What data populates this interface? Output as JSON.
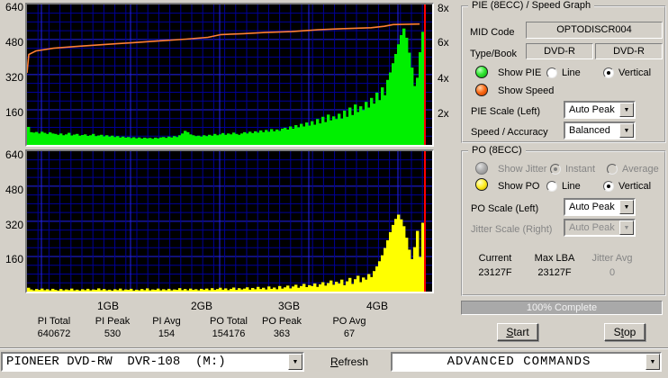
{
  "graph": {
    "left_axis_labels": [
      "640",
      "480",
      "320",
      "160"
    ],
    "right_axis_labels": [
      "8x",
      "6x",
      "4x",
      "2x"
    ],
    "x_axis_labels": [
      "1GB",
      "2GB",
      "3GB",
      "4GB"
    ],
    "position_marker_gb": 4.5,
    "colors": {
      "plot_bg": "#000000",
      "grid_minor": "#000098",
      "grid_major": "#2222ee",
      "pie": "#00f000",
      "po": "#ffff00",
      "speed": "#ff7f33",
      "cursor": "#ff0000"
    }
  },
  "chart_data": [
    {
      "type": "bar",
      "name": "PIE errors (top graph)",
      "color": "#00f000",
      "x_range_gb": [
        0,
        4.5
      ],
      "ylim_left": [
        0,
        640
      ],
      "values": [
        82,
        58,
        56,
        59,
        52,
        60,
        55,
        50,
        57,
        52,
        50,
        46,
        52,
        44,
        48,
        55,
        43,
        47,
        50,
        42,
        45,
        48,
        41,
        44,
        50,
        40,
        43,
        46,
        39,
        44,
        38,
        42,
        36,
        40,
        34,
        38,
        33,
        36,
        31,
        35,
        30,
        34,
        29,
        33,
        30,
        32,
        28,
        33,
        30,
        34,
        36,
        32,
        38,
        34,
        40,
        36,
        44,
        52,
        64,
        58,
        48,
        44,
        40,
        42,
        38,
        44,
        40,
        46,
        42,
        50,
        44,
        48,
        54,
        46,
        52,
        48,
        56,
        50,
        46,
        52,
        58,
        52,
        60,
        54,
        62,
        56,
        66,
        58,
        68,
        60,
        72,
        62,
        70,
        64,
        74,
        78,
        70,
        84,
        74,
        90,
        80,
        96,
        84,
        102,
        88,
        108,
        92,
        118,
        98,
        128,
        104,
        138,
        112,
        130,
        118,
        142,
        120,
        156,
        128,
        170,
        136,
        184,
        150,
        176,
        158,
        196,
        170,
        214,
        188,
        238,
        204,
        262,
        226,
        296,
        330,
        372,
        414,
        458,
        500,
        530,
        488,
        420,
        352,
        268,
        306,
        422,
        515
      ]
    },
    {
      "type": "line",
      "name": "Write speed (top graph)",
      "color": "#ff7f33",
      "ylim_right_x": [
        0,
        8
      ],
      "points_gb_speed": [
        [
          0,
          4.1
        ],
        [
          0.02,
          5.15
        ],
        [
          0.1,
          5.35
        ],
        [
          0.3,
          5.5
        ],
        [
          0.6,
          5.62
        ],
        [
          0.9,
          5.72
        ],
        [
          1.2,
          5.82
        ],
        [
          1.5,
          5.92
        ],
        [
          1.8,
          6.02
        ],
        [
          2.05,
          6.12
        ],
        [
          2.2,
          6.28
        ],
        [
          2.45,
          6.33
        ],
        [
          2.7,
          6.4
        ],
        [
          3.0,
          6.45
        ],
        [
          3.3,
          6.55
        ],
        [
          3.6,
          6.62
        ],
        [
          3.9,
          6.67
        ],
        [
          4.05,
          6.75
        ],
        [
          4.15,
          6.85
        ],
        [
          4.45,
          6.88
        ]
      ]
    },
    {
      "type": "bar",
      "name": "PO errors (bottom graph)",
      "color": "#ffff00",
      "x_range_gb": [
        0,
        4.5
      ],
      "ylim_left": [
        0,
        640
      ],
      "values": [
        18,
        10,
        6,
        12,
        8,
        14,
        7,
        11,
        6,
        13,
        8,
        5,
        12,
        6,
        10,
        7,
        14,
        6,
        9,
        5,
        11,
        7,
        13,
        6,
        10,
        8,
        15,
        7,
        12,
        6,
        9,
        5,
        11,
        7,
        14,
        6,
        10,
        8,
        13,
        5,
        9,
        6,
        12,
        7,
        15,
        6,
        10,
        8,
        14,
        6,
        11,
        7,
        13,
        6,
        10,
        8,
        16,
        7,
        12,
        6,
        14,
        8,
        11,
        6,
        13,
        9,
        14,
        7,
        16,
        8,
        12,
        18,
        9,
        15,
        7,
        13,
        19,
        8,
        16,
        10,
        14,
        20,
        9,
        17,
        11,
        22,
        12,
        18,
        10,
        24,
        13,
        19,
        11,
        26,
        14,
        20,
        28,
        15,
        24,
        32,
        18,
        26,
        36,
        21,
        30,
        26,
        38,
        22,
        34,
        44,
        28,
        40,
        52,
        32,
        46,
        38,
        56,
        30,
        48,
        64,
        36,
        58,
        74,
        44,
        66,
        56,
        82,
        68,
        96,
        118,
        142,
        170,
        204,
        240,
        278,
        312,
        340,
        360,
        338,
        306,
        252,
        196,
        152,
        208,
        284,
        162,
        322
      ]
    }
  ],
  "stats": {
    "columns": [
      {
        "label": "PI Total",
        "value": "640672"
      },
      {
        "label": "PI Peak",
        "value": "530"
      },
      {
        "label": "PI Avg",
        "value": "154"
      },
      {
        "label": "PO Total",
        "value": "154176"
      },
      {
        "label": "PO Peak",
        "value": "363"
      },
      {
        "label": "PO Avg",
        "value": "67"
      }
    ]
  },
  "pie_panel": {
    "title": "PIE (8ECC) / Speed Graph",
    "mid_label": "MID Code",
    "mid_value": "OPTODISCR004",
    "type_label": "Type/Book",
    "type_value": "DVD-R",
    "book_value": "DVD-R",
    "show_pie": "Show PIE",
    "show_speed": "Show Speed",
    "line": "Line",
    "vertical": "Vertical",
    "pie_scale_label": "PIE Scale (Left)",
    "pie_scale_value": "Auto Peak",
    "speed_accuracy_label": "Speed / Accuracy",
    "speed_accuracy_value": "Balanced"
  },
  "po_panel": {
    "title": "PO (8ECC)",
    "show_jitter": "Show Jitter",
    "instant": "Instant",
    "average": "Average",
    "show_po": "Show PO",
    "line": "Line",
    "vertical": "Vertical",
    "po_scale_label": "PO Scale (Left)",
    "po_scale_value": "Auto Peak",
    "jitter_scale_label": "Jitter Scale (Right)",
    "jitter_scale_value": "Auto Peak",
    "current_label": "Current",
    "current_value": "23127F",
    "max_lba_label": "Max LBA",
    "max_lba_value": "23127F",
    "jitter_avg_label": "Jitter Avg",
    "jitter_avg_value": "0"
  },
  "progress": {
    "text": "100% Complete",
    "percent": 100
  },
  "controls": {
    "start": {
      "label": "Start",
      "accel": 0
    },
    "stop": {
      "label": "Stop",
      "accel": 1
    }
  },
  "bottom_bar": {
    "drive": "PIONEER DVD-RW  DVR-108  (M:)",
    "refresh": {
      "label": "Refresh",
      "accel": 0
    },
    "advanced": "ADVANCED COMMANDS"
  }
}
